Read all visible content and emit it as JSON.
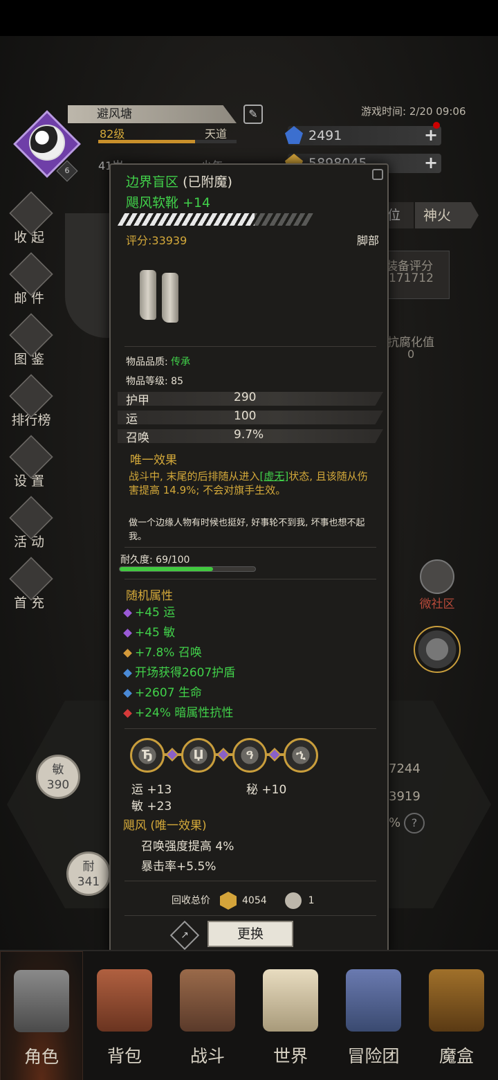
{
  "header": {
    "player_name": "避风塘",
    "level": "82级",
    "title": "天道",
    "xp_fraction": 0.7,
    "age": "41岁",
    "age_stage": "少年",
    "vip_level": "6",
    "game_time": "游戏时间: 2/20 09:06",
    "currency_gems": "2491",
    "currency_gold": "5898045"
  },
  "sidebar": {
    "items": [
      {
        "label": "收起",
        "icon": "collapse-icon"
      },
      {
        "label": "邮件",
        "icon": "mail-icon"
      },
      {
        "label": "图鉴",
        "icon": "book-icon"
      },
      {
        "label": "排行榜",
        "icon": "ranking-icon"
      },
      {
        "label": "设置",
        "icon": "gear-icon"
      },
      {
        "label": "活动",
        "icon": "event-icon"
      },
      {
        "label": "首充",
        "icon": "first-charge-icon"
      }
    ]
  },
  "background": {
    "tab_a": "位",
    "tab_b": "神火",
    "score_label": "装备评分",
    "score_value": "171712",
    "corruption_label": "抗腐化值",
    "corruption_value": "0",
    "micro_social": "微社区",
    "stat_a_label": "敏",
    "stat_a_value": "390",
    "stat_b_label": "耐",
    "stat_b_value": "341",
    "right_num_1": "7244",
    "right_num_2": "3919",
    "right_num_3": "%",
    "help": "?"
  },
  "item": {
    "name": "边界盲区",
    "enchant_tag": "(已附魔)",
    "subname": "飓风软靴 +14",
    "quality_fraction": 0.7,
    "score": "评分:33939",
    "slot": "脚部",
    "quality_label": "物品品质:",
    "quality_value": "传承",
    "level_label": "物品等级: 85",
    "stats": [
      {
        "k": "护甲",
        "v": "290"
      },
      {
        "k": "运",
        "v": "100"
      },
      {
        "k": "召唤",
        "v": "9.7%"
      }
    ],
    "unique_title": "唯一效果",
    "unique_text_1": "战斗中, 末尾的后排随从进入",
    "unique_link": "[虚无]",
    "unique_text_2": "状态, 且该随从伤害提高 14.9%; 不会对旗手生效。",
    "flavor": "做一个边缘人物有时候也挺好, 好事轮不到我, 坏事也想不起我。",
    "durability_label": "耐久度: 69/100",
    "durability_fraction": 0.69,
    "random_title": "随机属性",
    "random_attrs": [
      {
        "text": "+45 运",
        "color": "#9a5ad6"
      },
      {
        "text": "+45 敏",
        "color": "#9a5ad6"
      },
      {
        "text": "+7.8% 召唤",
        "color": "#d49a3a"
      },
      {
        "text": "开场获得2607护盾",
        "color": "#4a8ad6"
      },
      {
        "text": "+2607 生命",
        "color": "#4a8ad6"
      },
      {
        "text": "+24% 暗属性抗性",
        "color": "#d63a3a"
      }
    ],
    "sockets": [
      "Ђ",
      "Џ",
      "ዓ",
      "ኂ"
    ],
    "socket_stat_1": "运 +13",
    "socket_stat_2": "秘 +10",
    "socket_stat_3": "敏 +23",
    "set_title": "飓风 (唯一效果)",
    "set_line_1": "召唤强度提高 4%",
    "set_line_2": "暴击率+5.5%",
    "recycle_label": "回收总价",
    "recycle_gold": "4054",
    "recycle_shard": "1",
    "replace_button": "更换"
  },
  "bottom_nav": {
    "items": [
      {
        "label": "角色",
        "icon": "helmet-icon",
        "active": true
      },
      {
        "label": "背包",
        "icon": "backpack-icon",
        "active": false
      },
      {
        "label": "战斗",
        "icon": "sword-shield-icon",
        "active": false
      },
      {
        "label": "世界",
        "icon": "scroll-map-icon",
        "active": false
      },
      {
        "label": "冒险团",
        "icon": "castle-icon",
        "active": false
      },
      {
        "label": "魔盒",
        "icon": "magic-box-icon",
        "active": false
      }
    ]
  }
}
